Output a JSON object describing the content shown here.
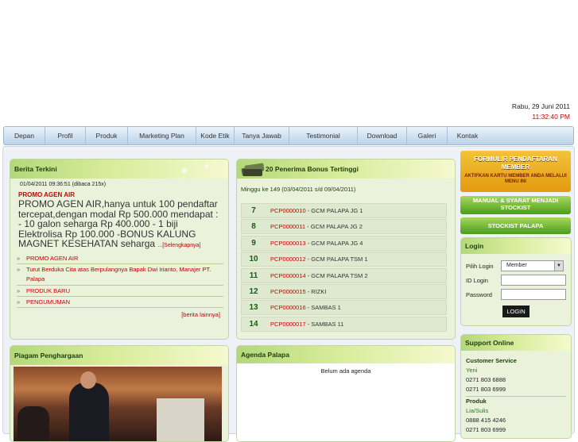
{
  "header": {
    "date": "Rabu, 29 Juni 2011",
    "time": "11:32:40 PM"
  },
  "nav": [
    "Depan",
    "Profil",
    "Produk",
    "Marketing Plan",
    "Kode Etik",
    "Tanya Jawab",
    "Testimonial",
    "Download",
    "Galeri",
    "Kontak"
  ],
  "berita": {
    "title": "Berita Terkini",
    "meta": "01/04/2011 09:36:51  (dibaca 215x)",
    "promo_title": "PROMO AGEN AIR",
    "promo_body": "PROMO AGEN AIR,hanya untuk 100 pendaftar tercepat,dengan modal Rp 500.000 mendapat : - 10 galon seharga Rp 400.000 - 1 biji Elektrolisa Rp 100.000 -BONUS KALUNG MAGNET KESEHATAN seharga",
    "more": "...[Selengkapnya]",
    "items": [
      "PROMO AGEN AIR",
      "Turut Berduka Cita atas Berpulangnya Bapak Dwi Irianto, Manajer PT. Palapa",
      "PRODUK BARU",
      "PENGUMUMAN"
    ],
    "lainnya": "[berita lainnya]"
  },
  "bonus": {
    "title": "20 Penerima Bonus Tertinggi",
    "period": "Minggu ke 149 (03/04/2011 s/d 09/04/2011)",
    "rows": [
      {
        "rank": "7",
        "code": "PCP0000010",
        "name": " - GCM PALAPA JG 1"
      },
      {
        "rank": "8",
        "code": "PCP0000011",
        "name": " - GCM PALAPA JG 2"
      },
      {
        "rank": "9",
        "code": "PCP0000013",
        "name": " - GCM PALAPA JG 4"
      },
      {
        "rank": "10",
        "code": "PCP0000012",
        "name": " - GCM PALAPA TSM 1"
      },
      {
        "rank": "11",
        "code": "PCP0000014",
        "name": " - GCM PALAPA TSM 2"
      },
      {
        "rank": "12",
        "code": "PCP0000015",
        "name": " - RIZKI"
      },
      {
        "rank": "13",
        "code": "PCP0000016",
        "name": " - SAMBAS 1"
      },
      {
        "rank": "14",
        "code": "PCP0000017",
        "name": " - SAMBAS 11"
      }
    ]
  },
  "banners": {
    "form_big": "FORMULIR PENDAFTARAN MEMBER",
    "form_small": "AKTIFKAN KARTU MEMBER ANDA MELALUI MENU INI",
    "manual": "MANUAL & SYARAT MENJADI STOCKIST",
    "stockist": "STOCKIST PALAPA"
  },
  "login": {
    "title": "Login",
    "pilih_label": "Pilih Login",
    "pilih_value": "Member",
    "id_label": "ID Login",
    "pw_label": "Password",
    "button": "LOGIN"
  },
  "support": {
    "title": "Support Online",
    "cs_label": "Customer Service",
    "cs_name": "Yeni",
    "cs_phone1": "0271 803 6888",
    "cs_phone2": "0271 803 6999",
    "prod_label": "Produk",
    "prod_name": "Lia/Sulis",
    "prod_phone1": "0888 415 4246",
    "prod_phone2": "0271 803 6999"
  },
  "piagam": {
    "title": "Piagam Penghargaan"
  },
  "agenda": {
    "title": "Agenda Palapa",
    "empty": "Belum ada agenda"
  }
}
